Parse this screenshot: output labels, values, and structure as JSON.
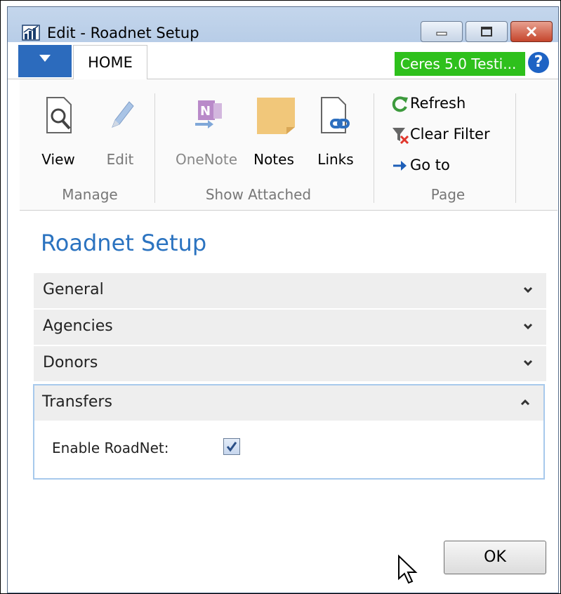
{
  "window": {
    "title": "Edit - Roadnet Setup"
  },
  "tabs": {
    "home_label": "HOME"
  },
  "badge": {
    "text": "Ceres 5.0 Testi..."
  },
  "help_icon": "?",
  "ribbon": {
    "manage": {
      "group_label": "Manage",
      "view_label": "View",
      "edit_label": "Edit"
    },
    "show_attached": {
      "group_label": "Show Attached",
      "onenote_label": "OneNote",
      "notes_label": "Notes",
      "links_label": "Links"
    },
    "page": {
      "group_label": "Page",
      "refresh_label": "Refresh",
      "clear_filter_label": "Clear Filter",
      "goto_label": "Go to"
    }
  },
  "page": {
    "title": "Roadnet Setup",
    "fasttabs": [
      {
        "label": "General",
        "expanded": false
      },
      {
        "label": "Agencies",
        "expanded": false
      },
      {
        "label": "Donors",
        "expanded": false
      },
      {
        "label": "Transfers",
        "expanded": true
      }
    ],
    "transfers": {
      "enable_roadnet_label": "Enable RoadNet:",
      "enable_roadnet_checked": true
    }
  },
  "buttons": {
    "ok_label": "OK"
  },
  "colors": {
    "accent_blue": "#2b73c0",
    "badge_green": "#2ec01c",
    "dropdown_blue": "#2c6bbd"
  }
}
